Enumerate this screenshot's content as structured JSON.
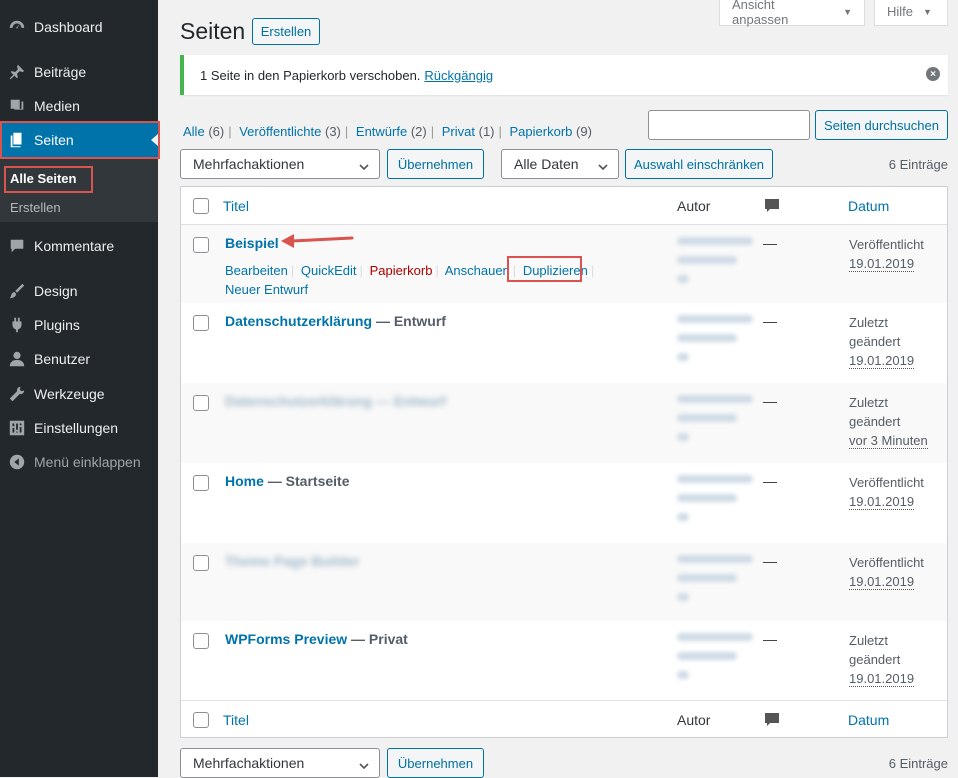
{
  "sidebar": {
    "items": [
      {
        "label": "Dashboard",
        "icon": "dashboard-icon"
      },
      {
        "label": "Beiträge",
        "icon": "pin-icon"
      },
      {
        "label": "Medien",
        "icon": "media-icon"
      },
      {
        "label": "Seiten",
        "icon": "pages-icon"
      },
      {
        "label": "Kommentare",
        "icon": "comment-icon"
      },
      {
        "label": "Design",
        "icon": "brush-icon"
      },
      {
        "label": "Plugins",
        "icon": "plugin-icon"
      },
      {
        "label": "Benutzer",
        "icon": "user-icon"
      },
      {
        "label": "Werkzeuge",
        "icon": "wrench-icon"
      },
      {
        "label": "Einstellungen",
        "icon": "settings-icon"
      },
      {
        "label": "Menü einklappen",
        "icon": "collapse-icon"
      }
    ],
    "submenu": [
      "Alle Seiten",
      "Erstellen"
    ]
  },
  "header": {
    "screen_options": "Ansicht anpassen",
    "help": "Hilfe",
    "title": "Seiten",
    "add_new": "Erstellen"
  },
  "notice": {
    "text": "1 Seite in den Papierkorb verschoben.",
    "undo": "Rückgängig"
  },
  "views": [
    {
      "label": "Alle",
      "count": "(6)"
    },
    {
      "label": "Veröffentlichte",
      "count": "(3)"
    },
    {
      "label": "Entwürfe",
      "count": "(2)"
    },
    {
      "label": "Privat",
      "count": "(1)"
    },
    {
      "label": "Papierkorb",
      "count": "(9)"
    }
  ],
  "search": {
    "button": "Seiten durchsuchen",
    "value": ""
  },
  "bulk": {
    "select": "Mehrfachaktionen",
    "apply": "Übernehmen"
  },
  "filter": {
    "date_select": "Alle Daten",
    "apply": "Auswahl einschränken"
  },
  "count": "6 Einträge",
  "columns": {
    "title": "Titel",
    "author": "Autor",
    "date": "Datum"
  },
  "rows": [
    {
      "title": "Beispiel",
      "state": "",
      "actions": [
        "Bearbeiten",
        "QuickEdit",
        "Papierkorb",
        "Anschauen",
        "Duplizieren",
        "Neuer Entwurf"
      ],
      "author": "—",
      "date_status": "Veröffentlicht",
      "date": "19.01.2019"
    },
    {
      "title": "Datenschutzerklärung",
      "state": "— Entwurf",
      "author": "—",
      "date_status": "Zuletzt geändert",
      "date": "19.01.2019"
    },
    {
      "title": "Datenschutzerklärung — Entwurf",
      "state": "",
      "author": "—",
      "date_status": "Zuletzt geändert",
      "date": "vor 3 Minuten"
    },
    {
      "title": "Home",
      "state": "— Startseite",
      "author": "—",
      "date_status": "Veröffentlicht",
      "date": "19.01.2019"
    },
    {
      "title": "Theme Page Builder",
      "state": "",
      "author": "—",
      "date_status": "Veröffentlicht",
      "date": "19.01.2019"
    },
    {
      "title": "WPForms Preview",
      "state": "— Privat",
      "author": "—",
      "date_status": "Zuletzt geändert",
      "date": "19.01.2019"
    }
  ],
  "colors": {
    "accent": "#0073aa",
    "sidebar": "#23282d",
    "highlight": "#d9534f",
    "notice": "#46b450"
  }
}
